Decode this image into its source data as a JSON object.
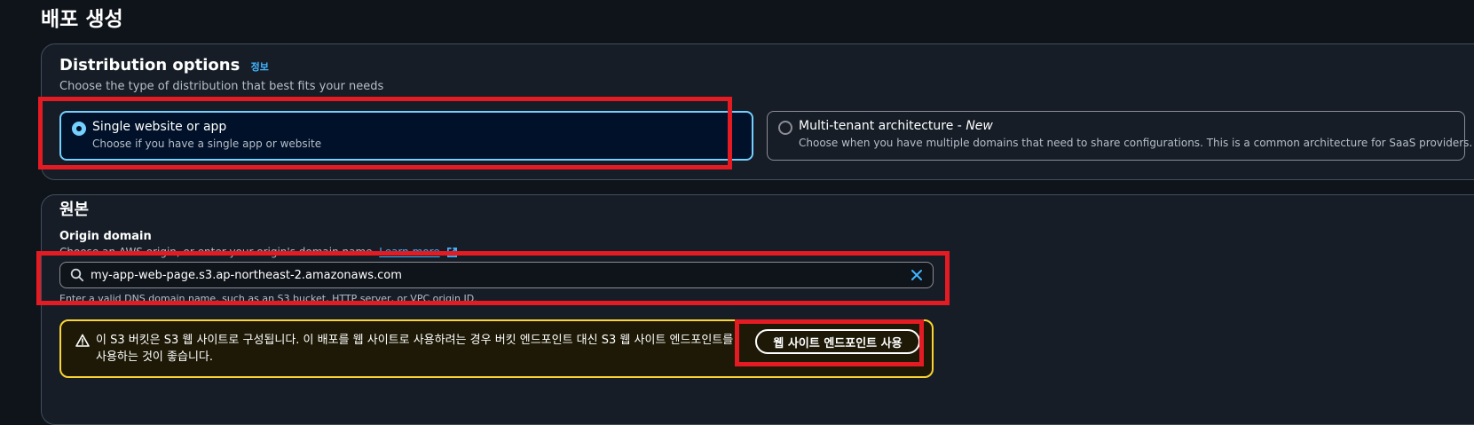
{
  "page": {
    "title": "배포 생성"
  },
  "distribution_options": {
    "title": "Distribution options",
    "info_link": "정보",
    "description": "Choose the type of distribution that best fits your needs",
    "options": [
      {
        "label": "Single website or app",
        "label_suffix": "",
        "description": "Choose if you have a single app or website",
        "selected": true
      },
      {
        "label": "Multi-tenant architecture - ",
        "label_suffix": "New",
        "description": "Choose when you have multiple domains that need to share configurations. This is a common architecture for SaaS providers.",
        "selected": false
      }
    ]
  },
  "origin": {
    "title": "원본",
    "field_label": "Origin domain",
    "field_description": "Choose an AWS origin, or enter your origin's domain name.",
    "learn_more": "Learn more",
    "input_value": "my-app-web-page.s3.ap-northeast-2.amazonaws.com",
    "hint": "Enter a valid DNS domain name, such as an S3 bucket, HTTP server, or VPC origin ID.",
    "alert_text": "이 S3 버킷은 S3 웹 사이트로 구성됩니다. 이 배포를 웹 사이트로 사용하려는 경우 버킷 엔드포인트 대신 S3 웹 사이트 엔드포인트를 사용하는 것이 좋습니다.",
    "alert_button": "웹 사이트 엔드포인트 사용"
  },
  "icons": {
    "radio_selected": "radio-selected-icon",
    "radio_unselected": "radio-unselected-icon",
    "external_link": "external-link-icon",
    "search": "search-icon",
    "clear": "close-icon",
    "warning": "warning-icon"
  },
  "colors": {
    "background": "#0f141a",
    "panel": "#161d26",
    "accent": "#42b4ff",
    "selected_border": "#75cfff",
    "warning": "#fbd332",
    "highlight": "#e51b23"
  }
}
